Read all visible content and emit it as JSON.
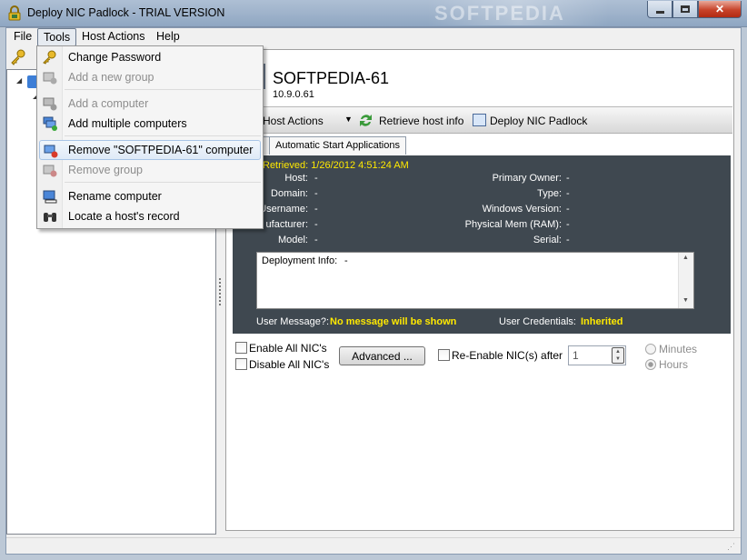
{
  "window": {
    "title": "Deploy NIC Padlock - TRIAL VERSION",
    "watermark": "SOFTPEDIA"
  },
  "menubar": [
    "File",
    "Tools",
    "Host Actions",
    "Help"
  ],
  "tools_menu": [
    {
      "label": "Change Password",
      "icon": "key-icon",
      "enabled": true
    },
    {
      "label": "Add a new group",
      "icon": "add-group-icon",
      "enabled": false
    },
    {
      "label": "Add a computer",
      "icon": "add-computer-icon",
      "enabled": false
    },
    {
      "label": "Add multiple computers",
      "icon": "add-multiple-computers-icon",
      "enabled": true
    },
    {
      "label": "Remove \"SOFTPEDIA-61\" computer",
      "icon": "remove-computer-icon",
      "enabled": true,
      "highlighted": true
    },
    {
      "label": "Remove group",
      "icon": "remove-group-icon",
      "enabled": false
    },
    {
      "label": "Rename computer",
      "icon": "rename-computer-icon",
      "enabled": true
    },
    {
      "label": "Locate a host's record",
      "icon": "binoculars-icon",
      "enabled": true
    }
  ],
  "host": {
    "name": "SOFTPEDIA-61",
    "ip": "10.9.0.61"
  },
  "actions": {
    "host_actions": "Host Actions",
    "retrieve": "Retrieve host info",
    "deploy": "Deploy NIC Padlock"
  },
  "tabs": [
    "Automatic Start Applications"
  ],
  "info": {
    "retrieved": "Retrieved: 1/26/2012 4:51:24 AM",
    "left": [
      {
        "label": "Host:",
        "value": "-"
      },
      {
        "label": "Domain:",
        "value": "-"
      },
      {
        "label": "Username:",
        "value": "-"
      },
      {
        "label": "ufacturer:",
        "value": "-"
      },
      {
        "label": "Model:",
        "value": "-"
      }
    ],
    "right": [
      {
        "label": "Primary Owner:",
        "value": "-"
      },
      {
        "label": "Type:",
        "value": "-"
      },
      {
        "label": "Windows Version:",
        "value": "-"
      },
      {
        "label": "Physical Mem (RAM):",
        "value": "-"
      },
      {
        "label": "Serial:",
        "value": "-"
      }
    ],
    "deployment_label": "Deployment Info:",
    "deployment_value": "-",
    "user_message_label": "User Message?:",
    "user_message_value": "No message will be shown",
    "credentials_label": "User Credentials:",
    "credentials_value": "Inherited"
  },
  "controls": {
    "enable_all": "Enable All NIC's",
    "disable_all": "Disable All NIC's",
    "advanced": "Advanced ...",
    "reenable": "Re-Enable NIC(s) after",
    "spin_value": "1",
    "minutes": "Minutes",
    "hours": "Hours"
  }
}
